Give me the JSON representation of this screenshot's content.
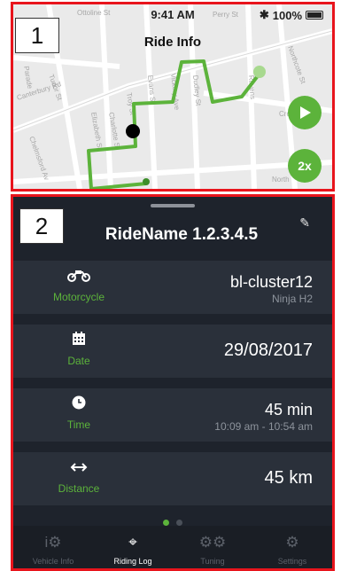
{
  "status_bar": {
    "time": "9:41 AM",
    "battery": "100%"
  },
  "map": {
    "title": "Ride Info",
    "streets": [
      "Ottoline St",
      "Perry St",
      "Northcote St",
      "Ravenshurt Ave",
      "Parade",
      "Canterbury Rd",
      "Tudor St",
      "Albert St",
      "Evans St",
      "Charlotte St",
      "Elizabeth St",
      "Vickery Ave",
      "Dudley St",
      "Cross St",
      "Chelmsford Ave",
      "North",
      "Troy St",
      "Hill St"
    ],
    "play_icon": "play-icon",
    "speed_label": "2x"
  },
  "callouts": {
    "one": "1",
    "two": "2"
  },
  "ride": {
    "name": "RideName 1.2.3.4.5",
    "edit_icon": "pencil-icon"
  },
  "rows": {
    "motorcycle": {
      "label": "Motorcycle",
      "value": "bl-cluster12",
      "sub": "Ninja H2",
      "icon": "motorcycle-icon"
    },
    "date": {
      "label": "Date",
      "value": "29/08/2017",
      "icon": "calendar-icon"
    },
    "time": {
      "label": "Time",
      "value": "45 min",
      "sub": "10:09 am - 10:54 am",
      "icon": "clock-icon"
    },
    "distance": {
      "label": "Distance",
      "value": "45 km",
      "icon": "arrows-horizontal-icon"
    }
  },
  "pager": {
    "count": 2,
    "active": 0
  },
  "tabs": [
    {
      "label": "Vehicle Info",
      "icon": "motorcycle-info-icon",
      "active": false
    },
    {
      "label": "Riding Log",
      "icon": "route-pin-icon",
      "active": true
    },
    {
      "label": "Tuning",
      "icon": "gears-icon",
      "active": false
    },
    {
      "label": "Settings",
      "icon": "settings-gear-icon",
      "active": false
    }
  ],
  "colors": {
    "accent": "#5cb33b",
    "panel": "#1e232c",
    "row": "#2a303a",
    "highlight": "#e8141c"
  }
}
